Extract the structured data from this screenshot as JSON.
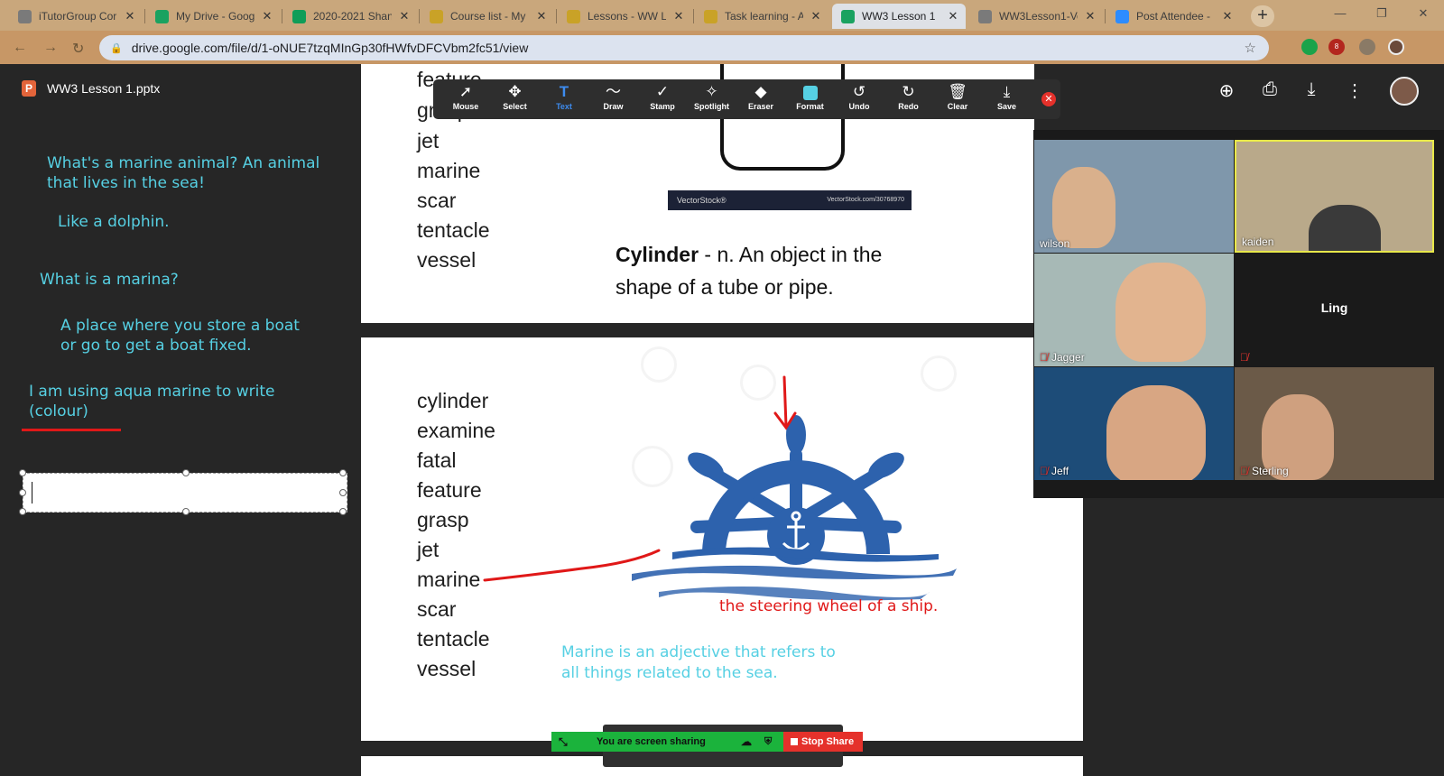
{
  "browser": {
    "tabs": [
      {
        "label": "iTutorGroup Cor",
        "icon": "globe-icon",
        "color": "#7a7a7a"
      },
      {
        "label": "My Drive - Goog",
        "icon": "drive-icon",
        "color": "#1aa260"
      },
      {
        "label": "2020-2021 Shan",
        "icon": "sheets-icon",
        "color": "#0f9d58"
      },
      {
        "label": "Course list - My",
        "icon": "person-icon",
        "color": "#c9a227"
      },
      {
        "label": "Lessons - WW L",
        "icon": "person-icon",
        "color": "#c9a227"
      },
      {
        "label": "Task learning - A",
        "icon": "person-icon",
        "color": "#c9a227"
      },
      {
        "label": "WW3 Lesson 1",
        "icon": "drive-icon",
        "color": "#1aa260"
      },
      {
        "label": "WW3Lesson1-Vo",
        "icon": "globe-icon",
        "color": "#7a7a7a"
      },
      {
        "label": "Post Attendee -",
        "icon": "zoom-icon",
        "color": "#2d8cff"
      }
    ],
    "active_tab": 6,
    "url": "drive.google.com/file/d/1-oNUE7tzqMInGp30fHWfvDFCVbm2fc51/view",
    "extension_badge": "8"
  },
  "drive": {
    "file_chip": "P",
    "file_name": "WW3 Lesson 1.pptx"
  },
  "notes": {
    "q1": "What's a marine animal?  An animal",
    "q1b": "that lives in the sea!",
    "a1": "Like a dolphin.",
    "q2": "What is a marina?",
    "a2": "A place where you store a boat",
    "a2b": "or go to get a boat fixed.",
    "q3": "I am using aqua marine to write",
    "q3b": "(colour)",
    "pen_color": "#56d0e3"
  },
  "slide1": {
    "words": [
      "feature",
      "grasp",
      "jet",
      "marine",
      "scar",
      "tentacle",
      "vessel"
    ],
    "watermark": "VectorStock®",
    "watermark_url": "VectorStock.com/30768970",
    "def_term": "Cylinder",
    "def_rest": " - n. An object in the",
    "def_line2": "shape  of a tube or pipe."
  },
  "slide2": {
    "words": [
      "cylinder",
      "examine",
      "fatal",
      "feature",
      "grasp",
      "jet",
      "marine",
      "scar",
      "tentacle",
      "vessel"
    ],
    "red_note": "the steering wheel of a ship.",
    "aqua_note1": "Marine is an adjective that refers to",
    "aqua_note2": "all things related to the sea."
  },
  "zoom_toolbar": {
    "tools": [
      {
        "label": "Mouse",
        "icon": "cursor-icon",
        "glyph": "➚"
      },
      {
        "label": "Select",
        "icon": "move-icon",
        "glyph": "✥"
      },
      {
        "label": "Text",
        "icon": "text-icon",
        "glyph": "T"
      },
      {
        "label": "Draw",
        "icon": "squiggle-icon",
        "glyph": "〜"
      },
      {
        "label": "Stamp",
        "icon": "check-icon",
        "glyph": "✓"
      },
      {
        "label": "Spotlight",
        "icon": "spotlight-icon",
        "glyph": "✧"
      },
      {
        "label": "Eraser",
        "icon": "eraser-icon",
        "glyph": "◆"
      },
      {
        "label": "Format",
        "icon": "format-icon",
        "glyph": ""
      },
      {
        "label": "Undo",
        "icon": "undo-icon",
        "glyph": "↺"
      },
      {
        "label": "Redo",
        "icon": "redo-icon",
        "glyph": "↻"
      },
      {
        "label": "Clear",
        "icon": "trash-icon",
        "glyph": "🗑"
      },
      {
        "label": "Save",
        "icon": "save-icon",
        "glyph": "⤓"
      }
    ],
    "selected": "Text"
  },
  "participants": [
    {
      "name": "wilson",
      "muted": false,
      "bg": "#7f97ab"
    },
    {
      "name": "kaiden",
      "muted": false,
      "bg": "#b9a98a"
    },
    {
      "name": "Jagger",
      "muted": true,
      "bg": "#a7b9b6"
    },
    {
      "name": "Ling",
      "muted": true,
      "bg": "#1a1a1a"
    },
    {
      "name": "Jeff",
      "muted": true,
      "bg": "#1d4c78"
    },
    {
      "name": "Sterling",
      "muted": true,
      "bg": "#6b5a48"
    }
  ],
  "sharing": {
    "status": "You are screen sharing",
    "stop": "Stop Share"
  }
}
